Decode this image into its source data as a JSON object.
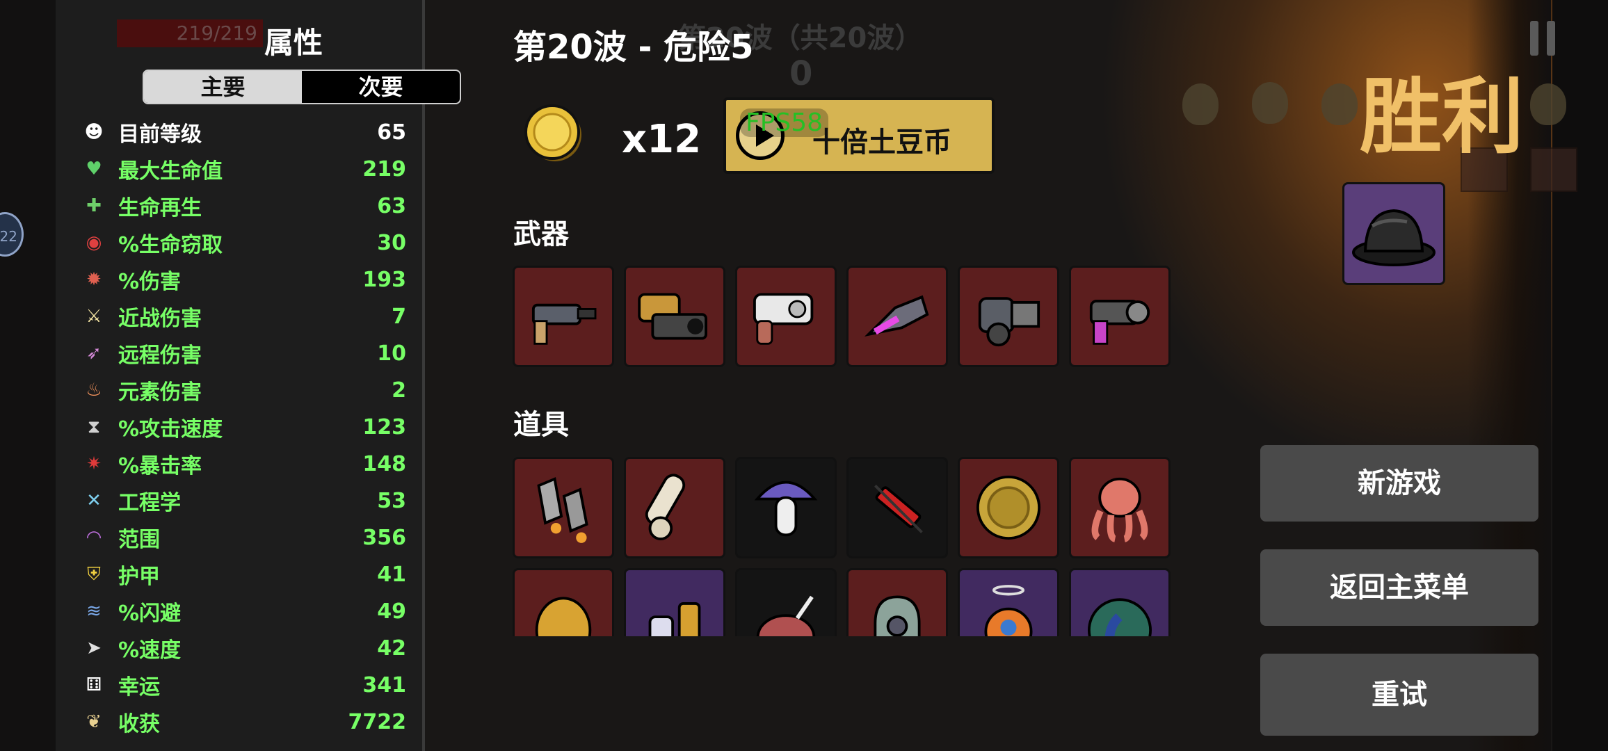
{
  "stats_panel": {
    "title": "属性",
    "ghost_hp": "219/219",
    "tabs": {
      "primary": "主要",
      "secondary": "次要"
    },
    "stats": [
      {
        "label": "目前等级",
        "value": "65",
        "icon": "level-icon"
      },
      {
        "label": "最大生命值",
        "value": "219",
        "icon": "heart-icon"
      },
      {
        "label": "生命再生",
        "value": "63",
        "icon": "regen-icon"
      },
      {
        "label": "%生命窃取",
        "value": "30",
        "icon": "lifesteal-icon"
      },
      {
        "label": "%伤害",
        "value": "193",
        "icon": "damage-icon"
      },
      {
        "label": "近战伤害",
        "value": "7",
        "icon": "melee-icon"
      },
      {
        "label": "远程伤害",
        "value": "10",
        "icon": "ranged-icon"
      },
      {
        "label": "元素伤害",
        "value": "2",
        "icon": "elemental-icon"
      },
      {
        "label": "%攻击速度",
        "value": "123",
        "icon": "attack-speed-icon"
      },
      {
        "label": "%暴击率",
        "value": "148",
        "icon": "crit-icon"
      },
      {
        "label": "工程学",
        "value": "53",
        "icon": "engineering-icon"
      },
      {
        "label": "范围",
        "value": "356",
        "icon": "range-icon"
      },
      {
        "label": "护甲",
        "value": "41",
        "icon": "armor-icon"
      },
      {
        "label": "%闪避",
        "value": "49",
        "icon": "dodge-icon"
      },
      {
        "label": "%速度",
        "value": "42",
        "icon": "speed-icon"
      },
      {
        "label": "幸运",
        "value": "341",
        "icon": "luck-icon"
      },
      {
        "label": "收获",
        "value": "7722",
        "icon": "harvest-icon"
      }
    ]
  },
  "side_badge": "22",
  "header": {
    "wave_title": "第20波 - 危险5",
    "ghost_wave": "第20波（共20波）",
    "ghost_zero": "0"
  },
  "reward": {
    "coin_count": "x12",
    "fps": "FPS58",
    "bonus_label": "十倍土豆币"
  },
  "weapons": {
    "title": "武器",
    "slots": [
      {
        "icon": "gun-icon",
        "rarity": "red"
      },
      {
        "icon": "cannon-icon",
        "rarity": "red"
      },
      {
        "icon": "revolver-icon",
        "rarity": "red"
      },
      {
        "icon": "laser-gun-icon",
        "rarity": "red"
      },
      {
        "icon": "minigun-icon",
        "rarity": "red"
      },
      {
        "icon": "blaster-icon",
        "rarity": "red"
      }
    ]
  },
  "items": {
    "title": "道具",
    "slots": [
      {
        "icon": "rockets-icon",
        "rarity": "red"
      },
      {
        "icon": "scroll-icon",
        "rarity": "red"
      },
      {
        "icon": "mushroom-icon",
        "rarity": "black"
      },
      {
        "icon": "syringe-icon",
        "rarity": "black"
      },
      {
        "icon": "gold-coin-icon",
        "rarity": "red"
      },
      {
        "icon": "octopus-icon",
        "rarity": "red"
      },
      {
        "icon": "potato-icon",
        "rarity": "red"
      },
      {
        "icon": "potion-icon",
        "rarity": "purple"
      },
      {
        "icon": "creature-icon",
        "rarity": "black"
      },
      {
        "icon": "pod-icon",
        "rarity": "red"
      },
      {
        "icon": "angel-robot-icon",
        "rarity": "purple"
      },
      {
        "icon": "peacock-icon",
        "rarity": "purple"
      }
    ]
  },
  "result": {
    "victory": "胜利",
    "character_icon": "bowler-hat-icon"
  },
  "menu": {
    "new_game": "新游戏",
    "main_menu": "返回主菜单",
    "retry": "重试"
  },
  "colors": {
    "stat_green": "#77ff66",
    "victory_gold": "#f0c068",
    "bonus_gold": "#d6b452",
    "slot_red": "#5c1e1e",
    "slot_purple": "#412a60",
    "button_gray": "#4a4a4a"
  }
}
